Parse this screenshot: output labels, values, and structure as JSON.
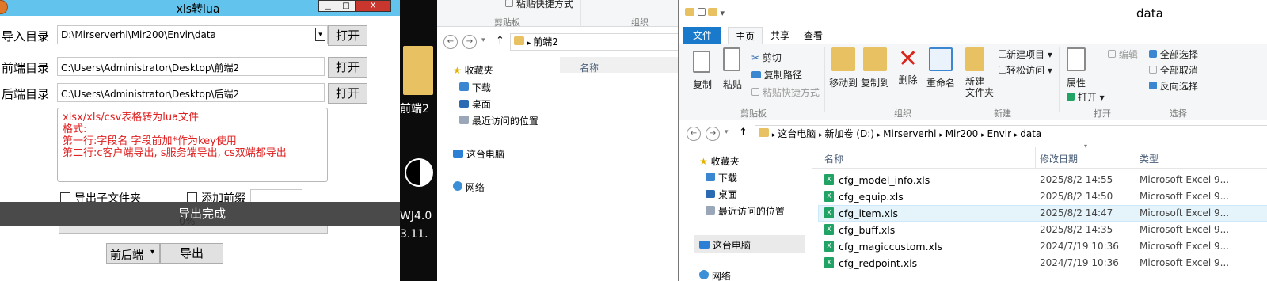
{
  "xls_window": {
    "title": "xls转lua",
    "minimize": "▁",
    "maximize": "□",
    "close": "X",
    "import_label": "导入目录",
    "import_path": "D:\\Mirserverhl\\Mir200\\Envir\\data",
    "import_open": "打开",
    "front_label": "前端目录",
    "front_path": "C:\\Users\\Administrator\\Desktop\\前端2",
    "front_open": "打开",
    "back_label": "后端目录",
    "back_path": "C:\\Users\\Administrator\\Desktop\\后端2",
    "back_open": "打开",
    "notes": [
      "xlsx/xls/csv表格转为lua文件",
      "格式:",
      "第一行:字段名 字段前加*作为key使用",
      "第二行:c客户端导出, s服务端导出, cs双端都导出"
    ],
    "export_subfolder": "导出子文件夹",
    "add_prefix": "添加前缀",
    "toast": "导出完成",
    "progress": "0%",
    "progress_value": 0,
    "mode_select": "前后端",
    "export_button": "导出"
  },
  "desktop": {
    "icon_label": "前端2",
    "line1": "WJ4.0",
    "line2": "3.11."
  },
  "explorer_bg": {
    "ribbon_partial": "粘贴快捷方式",
    "group_clipboard": "剪贴板",
    "group_organize": "组织",
    "address": "前端2",
    "col_name": "名称",
    "tree": [
      "收藏夹",
      "下载",
      "桌面",
      "最近访问的位置",
      "这台电脑",
      "网络"
    ]
  },
  "explorer": {
    "title": "data",
    "tabs": [
      "文件",
      "主页",
      "共享",
      "查看"
    ],
    "ribbon": {
      "copy": "复制",
      "paste": "粘贴",
      "cut": "剪切",
      "copy_path": "复制路径",
      "paste_shortcut": "粘贴快捷方式",
      "move_to": "移动到",
      "copy_to": "复制到",
      "delete": "删除",
      "rename": "重命名",
      "new_folder": "新建\n文件夹",
      "new_item": "新建项目",
      "easy_access": "轻松访问",
      "properties": "属性",
      "open": "打开",
      "edit": "编辑",
      "select_all": "全部选择",
      "select_none": "全部取消",
      "invert": "反向选择",
      "g_clipboard": "剪贴板",
      "g_organize": "组织",
      "g_new": "新建",
      "g_open": "打开",
      "g_select": "选择"
    },
    "breadcrumb": [
      "这台电脑",
      "新加卷 (D:)",
      "Mirserverhl",
      "Mir200",
      "Envir",
      "data"
    ],
    "tree": [
      "收藏夹",
      "下载",
      "桌面",
      "最近访问的位置",
      "这台电脑",
      "网络"
    ],
    "columns": [
      "名称",
      "修改日期",
      "类型"
    ],
    "files": [
      {
        "name": "cfg_model_info.xls",
        "date": "2025/8/2 14:55",
        "type": "Microsoft Excel 9..."
      },
      {
        "name": "cfg_equip.xls",
        "date": "2025/8/2 14:50",
        "type": "Microsoft Excel 9..."
      },
      {
        "name": "cfg_item.xls",
        "date": "2025/8/2 14:47",
        "type": "Microsoft Excel 9..."
      },
      {
        "name": "cfg_buff.xls",
        "date": "2025/8/2 14:35",
        "type": "Microsoft Excel 9..."
      },
      {
        "name": "cfg_magiccustom.xls",
        "date": "2024/7/19 10:36",
        "type": "Microsoft Excel 9..."
      },
      {
        "name": "cfg_redpoint.xls",
        "date": "2024/7/19 10:36",
        "type": "Microsoft Excel 9..."
      }
    ]
  }
}
